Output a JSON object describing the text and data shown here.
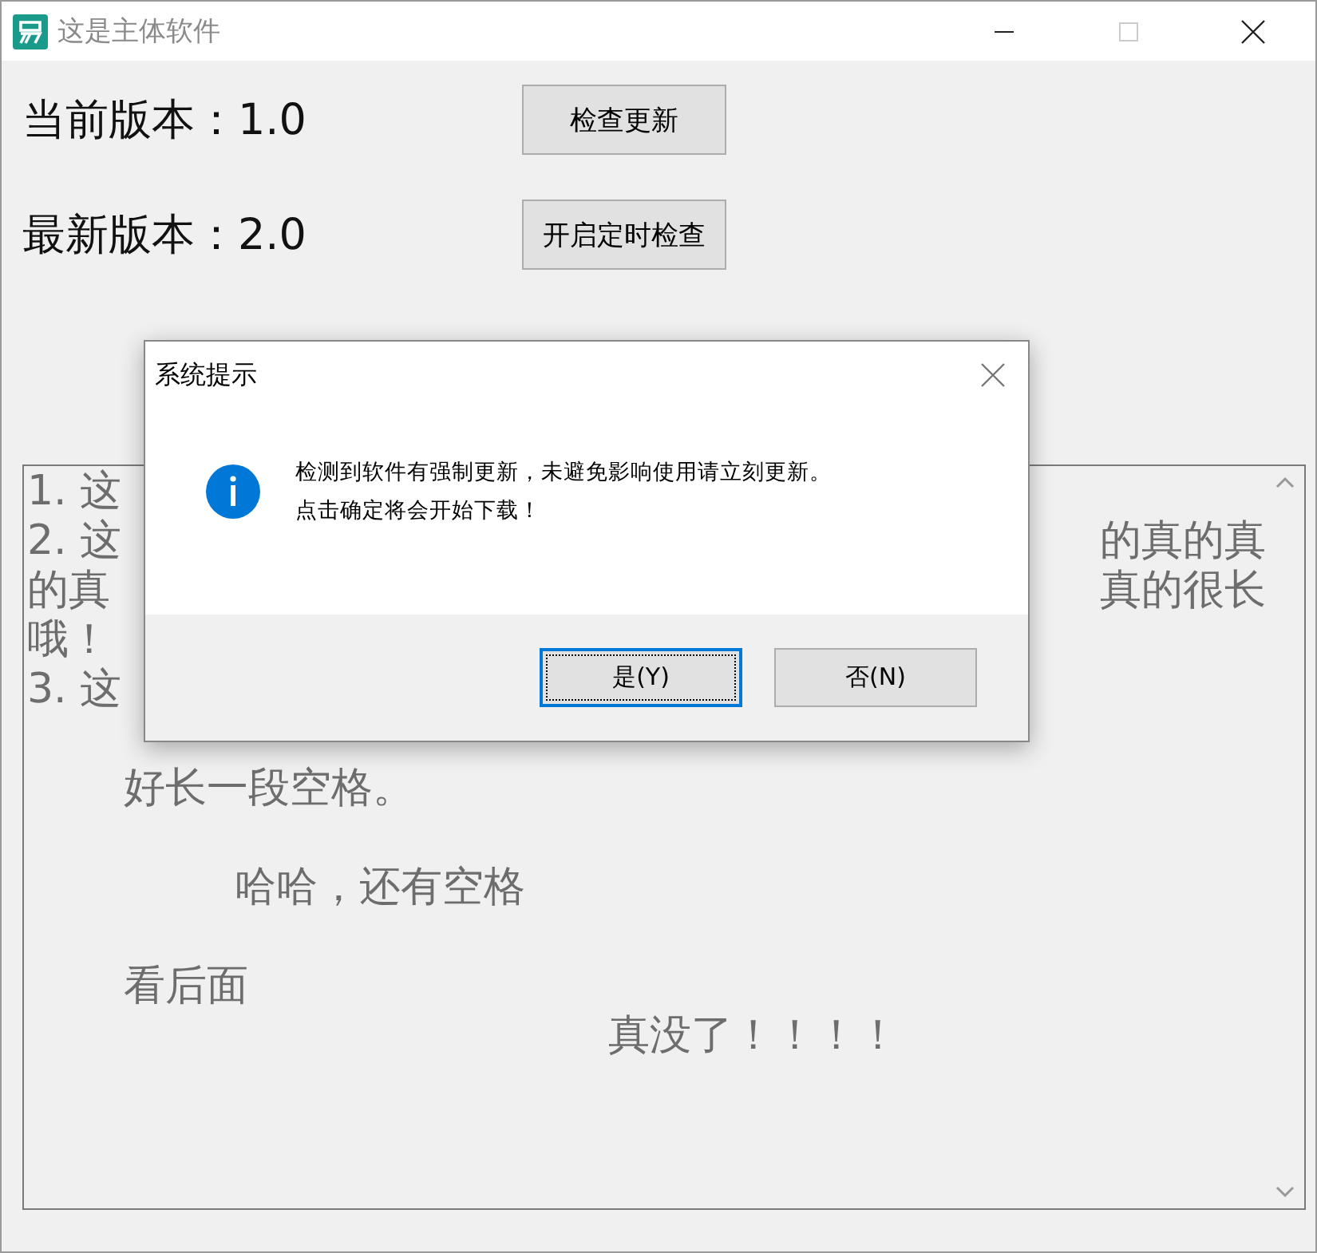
{
  "window": {
    "title": "这是主体软件"
  },
  "version_labels": [
    "当前版本：1.0",
    "最新版本：2.0"
  ],
  "buttons": [
    "检查更新",
    "开启定时检查"
  ],
  "text_area": {
    "lines": [
      {
        "left": "1. 这"
      },
      {
        "left": "2. 这",
        "right": "的真的真"
      },
      {
        "left": "的真",
        "right": "真的很长"
      },
      {
        "left": "哦！"
      },
      {
        "left": "3. 这"
      },
      {
        "kind": "blank"
      },
      {
        "left": "　　 好长一段空格。"
      },
      {
        "kind": "blank"
      },
      {
        "left": "　　　　　哈哈，还有空格"
      },
      {
        "kind": "blank"
      },
      {
        "left": "　　 看后面"
      },
      {
        "left": "　　　　　　　　　　　　　　真没了！！！！"
      }
    ]
  },
  "dialog": {
    "title": "系统提示",
    "message": [
      "检测到软件有强制更新，未避免影响使用请立刻更新。",
      "点击确定将会开始下载！"
    ],
    "buttons": [
      {
        "label": "是(Y)",
        "selected": true
      },
      {
        "label": "否(N)",
        "selected": false
      }
    ]
  }
}
